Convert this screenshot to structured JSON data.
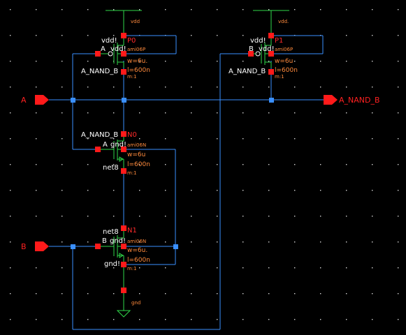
{
  "schematic": {
    "pins": {
      "input_a": "A",
      "input_b": "B",
      "output": "A_NAND_B"
    },
    "supplies": {
      "vdd": "vdd",
      "vdd_p1": "vdd.",
      "gnd": "gnd"
    },
    "transistors": {
      "p0": {
        "instance": "P0",
        "model": "ami06P",
        "w": "w=6u.",
        "l": "l=600n",
        "m": "m:1",
        "gate": "A",
        "bulk": "vdd!",
        "source": "vdd!",
        "drain": "A_NAND_B"
      },
      "p1": {
        "instance": "P1",
        "model": "ami06P",
        "w": "w=6u",
        "l": "l=600n",
        "m": "m:1",
        "gate": "B",
        "bulk": "vdd!",
        "source": "vdd!",
        "drain": "A_NAND_B"
      },
      "n0": {
        "instance": "N0",
        "model": "ami06N",
        "w": "w=6u",
        "l": "l=600n",
        "m": "m:1",
        "gate": "A",
        "bulk": "gnd!",
        "drain": "A_NAND_B",
        "source": "net8"
      },
      "n1": {
        "instance": "N1",
        "model": "ami06N",
        "w": "w=6u.",
        "l": "l=600n",
        "m": "m:1",
        "gate": "B",
        "bulk": "gnd!",
        "drain": "net8",
        "source": "gnd!"
      }
    },
    "colors": {
      "background": "#000000",
      "wire": "#3a8fff",
      "device": "#2fd84a",
      "pin": "#ff1a1a",
      "property": "#ff8a3c",
      "net_label": "#ffffff"
    }
  }
}
